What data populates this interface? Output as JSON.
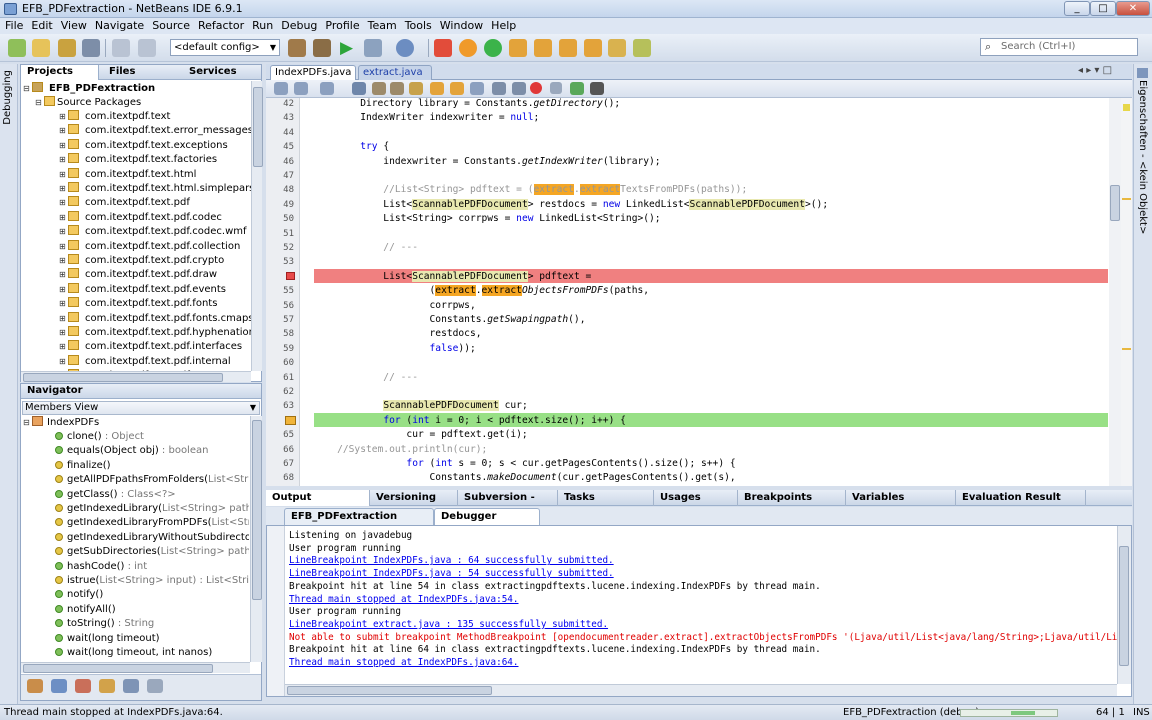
{
  "window": {
    "title": "EFB_PDFextraction - NetBeans IDE 6.9.1"
  },
  "menu": [
    "File",
    "Edit",
    "View",
    "Navigate",
    "Source",
    "Refactor",
    "Run",
    "Debug",
    "Profile",
    "Team",
    "Tools",
    "Window",
    "Help"
  ],
  "toolbar": {
    "config": "<default config>",
    "search_placeholder": "Search (Ctrl+I)"
  },
  "projects": {
    "tabs": [
      "Projects",
      "Files",
      "Services"
    ],
    "root": "EFB_PDFextraction",
    "source_packages": "Source Packages",
    "packages": [
      "com.itextpdf.text",
      "com.itextpdf.text.error_messages",
      "com.itextpdf.text.exceptions",
      "com.itextpdf.text.factories",
      "com.itextpdf.text.html",
      "com.itextpdf.text.html.simpleparser",
      "com.itextpdf.text.pdf",
      "com.itextpdf.text.pdf.codec",
      "com.itextpdf.text.pdf.codec.wmf",
      "com.itextpdf.text.pdf.collection",
      "com.itextpdf.text.pdf.crypto",
      "com.itextpdf.text.pdf.draw",
      "com.itextpdf.text.pdf.events",
      "com.itextpdf.text.pdf.fonts",
      "com.itextpdf.text.pdf.fonts.cmaps",
      "com.itextpdf.text.pdf.hyphenation",
      "com.itextpdf.text.pdf.interfaces",
      "com.itextpdf.text.pdf.internal",
      "com.itextpdf.text.pdf.parser"
    ]
  },
  "navigator": {
    "title": "Navigator",
    "view": "Members View",
    "class": "IndexPDFs",
    "members": [
      {
        "name": "clone()",
        "sig": " : Object"
      },
      {
        "name": "equals(Object obj)",
        "sig": " : boolean"
      },
      {
        "name": "finalize()",
        "sig": ""
      },
      {
        "name": "getAllPDFpathsFromFolders(",
        "sig": "List<String> folde"
      },
      {
        "name": "getClass()",
        "sig": " : Class<?>"
      },
      {
        "name": "getIndexedLibrary(",
        "sig": "List<String> paths) : Direct"
      },
      {
        "name": "getIndexedLibraryFromPDFs(",
        "sig": "List<String> path"
      },
      {
        "name": "getIndexedLibraryWithoutSubdirectories(",
        "sig": "List<"
      },
      {
        "name": "getSubDirectories(",
        "sig": "List<String> paths) : List<S"
      },
      {
        "name": "hashCode()",
        "sig": " : int"
      },
      {
        "name": "istrue(",
        "sig": "List<String> input) : List<String>"
      },
      {
        "name": "notify()",
        "sig": ""
      },
      {
        "name": "notifyAll()",
        "sig": ""
      },
      {
        "name": "toString()",
        "sig": " : String"
      },
      {
        "name": "wait(long timeout)",
        "sig": ""
      },
      {
        "name": "wait(long timeout, int nanos)",
        "sig": ""
      }
    ]
  },
  "editor": {
    "tabs": [
      "IndexPDFs.java",
      "extract.java"
    ],
    "lines": [
      {
        "n": "42",
        "t": "        Directory library = Constants.getDirectory();"
      },
      {
        "n": "43",
        "t": "        IndexWriter indexwriter = null;"
      },
      {
        "n": "44",
        "t": ""
      },
      {
        "n": "45",
        "t": "        try {"
      },
      {
        "n": "46",
        "t": "            indexwriter = Constants.getIndexWriter(library);"
      },
      {
        "n": "47",
        "t": ""
      },
      {
        "n": "48",
        "t": "            //List<String> pdftext = (extract.extractTextsFromPDFs(paths));"
      },
      {
        "n": "49",
        "t": "            List<ScannablePDFDocument> restdocs = new LinkedList<ScannablePDFDocument>();"
      },
      {
        "n": "50",
        "t": "            List<String> corrpws = new LinkedList<String>();"
      },
      {
        "n": "51",
        "t": ""
      },
      {
        "n": "52",
        "t": "            // ---"
      },
      {
        "n": "53",
        "t": ""
      },
      {
        "n": "",
        "t": "            List<ScannablePDFDocument> pdftext ="
      },
      {
        "n": "55",
        "t": "                    (extract.extractObjectsFromPDFs(paths,"
      },
      {
        "n": "56",
        "t": "                    corrpws,"
      },
      {
        "n": "57",
        "t": "                    Constants.getSwapingpath(),"
      },
      {
        "n": "58",
        "t": "                    restdocs,"
      },
      {
        "n": "59",
        "t": "                    false));"
      },
      {
        "n": "60",
        "t": ""
      },
      {
        "n": "61",
        "t": "            // ---"
      },
      {
        "n": "62",
        "t": ""
      },
      {
        "n": "63",
        "t": "            ScannablePDFDocument cur;"
      },
      {
        "n": "",
        "t": "            for (int i = 0; i < pdftext.size(); i++) {"
      },
      {
        "n": "65",
        "t": "                cur = pdftext.get(i);"
      },
      {
        "n": "66",
        "t": "    //System.out.println(cur);"
      },
      {
        "n": "67",
        "t": "                for (int s = 0; s < cur.getPagesContents().size(); s++) {"
      },
      {
        "n": "68",
        "t": "                    Constants.makeDocument(cur.getPagesContents().get(s),"
      }
    ]
  },
  "output": {
    "tabs": [
      "Output",
      "Versioning Output",
      "Subversion - Auto...",
      "Tasks",
      "Usages",
      "Breakpoints",
      "Variables",
      "Evaluation Result"
    ],
    "subtabs": [
      "EFB_PDFextraction (debug)",
      "Debugger Console"
    ],
    "lines": [
      {
        "t": "Listening on javadebug",
        "k": "n"
      },
      {
        "t": "User program running",
        "k": "n"
      },
      {
        "t": "LineBreakpoint IndexPDFs.java : 64 successfully submitted.",
        "k": "l"
      },
      {
        "t": "LineBreakpoint IndexPDFs.java : 54 successfully submitted.",
        "k": "l"
      },
      {
        "t": "Breakpoint hit at line 54 in class extractingpdftexts.lucene.indexing.IndexPDFs by thread main.",
        "k": "n"
      },
      {
        "t": "Thread main stopped at IndexPDFs.java:54.",
        "k": "l"
      },
      {
        "t": "User program running",
        "k": "n"
      },
      {
        "t": "LineBreakpoint extract.java : 135 successfully submitted.",
        "k": "l"
      },
      {
        "t": "Not able to submit breakpoint MethodBreakpoint [opendocumentreader.extract].extractObjectsFromPDFs '(Ljava/util/List<java/lang/String>;Ljava/util/Li",
        "k": "e"
      },
      {
        "t": "Breakpoint hit at line 64 in class extractingpdftexts.lucene.indexing.IndexPDFs by thread main.",
        "k": "n"
      },
      {
        "t": "Thread main stopped at IndexPDFs.java:64.",
        "k": "l"
      }
    ]
  },
  "statusbar": {
    "left": "Thread main stopped at IndexPDFs.java:64.",
    "session": "EFB_PDFextraction (debug)",
    "position": "64 | 1",
    "mode": "INS"
  },
  "sidestrips": {
    "left": "Debugging",
    "right": "Eigenschaften - <kein Objekt>"
  }
}
